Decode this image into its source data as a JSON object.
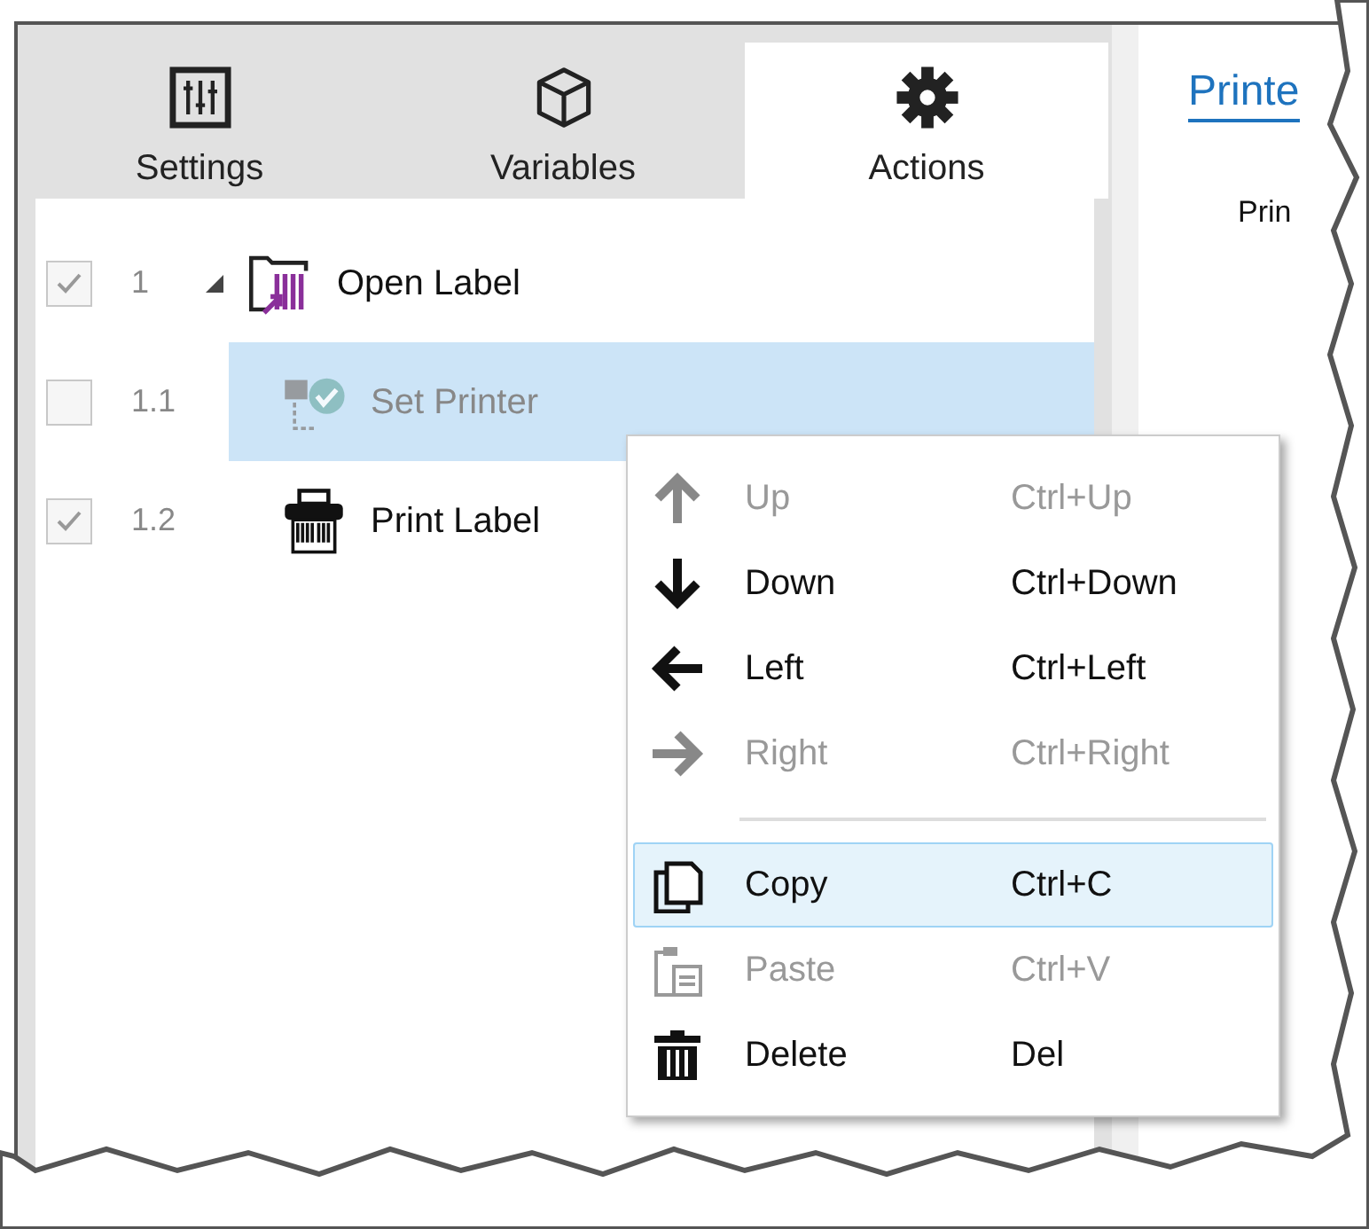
{
  "tabs": [
    {
      "label": "Settings",
      "selected": false
    },
    {
      "label": "Variables",
      "selected": false
    },
    {
      "label": "Actions",
      "selected": true
    }
  ],
  "actions": [
    {
      "number": "1",
      "label": "Open Label",
      "checked": true,
      "expanded": true,
      "selected": false,
      "disabled": false,
      "children": [
        {
          "number": "1.1",
          "label": "Set Printer",
          "checked": false,
          "selected": true,
          "disabled": true
        },
        {
          "number": "1.2",
          "label": "Print Label",
          "checked": true,
          "selected": false,
          "disabled": false
        }
      ]
    }
  ],
  "right_pane": {
    "link": "Printe",
    "text": "Prin"
  },
  "context_menu": [
    {
      "kind": "item",
      "label": "Up",
      "shortcut": "Ctrl+Up",
      "disabled": true,
      "selected": false
    },
    {
      "kind": "item",
      "label": "Down",
      "shortcut": "Ctrl+Down",
      "disabled": false,
      "selected": false
    },
    {
      "kind": "item",
      "label": "Left",
      "shortcut": "Ctrl+Left",
      "disabled": false,
      "selected": false
    },
    {
      "kind": "item",
      "label": "Right",
      "shortcut": "Ctrl+Right",
      "disabled": true,
      "selected": false
    },
    {
      "kind": "separator"
    },
    {
      "kind": "item",
      "label": "Copy",
      "shortcut": "Ctrl+C",
      "disabled": false,
      "selected": true
    },
    {
      "kind": "item",
      "label": "Paste",
      "shortcut": "Ctrl+V",
      "disabled": true,
      "selected": false
    },
    {
      "kind": "item",
      "label": "Delete",
      "shortcut": "Del",
      "disabled": false,
      "selected": false
    }
  ]
}
